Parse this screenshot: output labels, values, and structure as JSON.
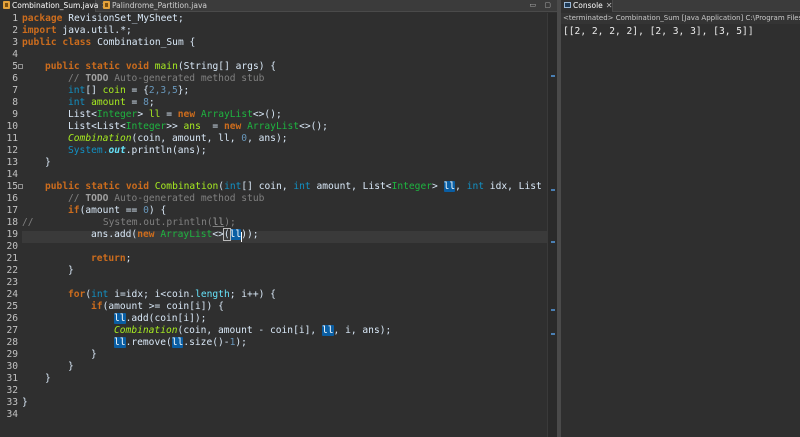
{
  "editor": {
    "tabs": [
      {
        "label": "Combination_Sum.java",
        "active": true
      },
      {
        "label": "Palindrome_Partition.java",
        "active": false
      }
    ],
    "line_numbers": [
      "1",
      "2",
      "3",
      "4",
      "5",
      "6",
      "7",
      "8",
      "9",
      "10",
      "11",
      "12",
      "13",
      "14",
      "15",
      "16",
      "17",
      "18",
      "19",
      "20",
      "21",
      "22",
      "23",
      "24",
      "25",
      "26",
      "27",
      "28",
      "29",
      "30",
      "31",
      "32",
      "33",
      "34"
    ],
    "code": {
      "l1_kw": "package",
      "l1_txt": " RevisionSet_MySheet;",
      "l2_kw": "import",
      "l2_txt": " java.util.*;",
      "l3_kw": "public class",
      "l3_txt": " Combination_Sum {",
      "l5_kw": "public static void",
      "l5_m": " main",
      "l5_a": "(String[] args) {",
      "l6_c1": "// ",
      "l6_todo": "TODO",
      "l6_c2": " Auto-generated method stub",
      "l7_ty": "int",
      "l7_a": "[] ",
      "l7_v": "coin",
      "l7_b": " = {",
      "l7_n": "2,3,5",
      "l7_c": "};",
      "l8_ty": "int",
      "l8_a": " ",
      "l8_v": "amount",
      "l8_b": " = ",
      "l8_n": "8",
      "l8_c": ";",
      "l9_a": "List<",
      "l9_cls": "Integer",
      "l9_b": "> ",
      "l9_v": "ll",
      "l9_c": " = ",
      "l9_kw": "new",
      "l9_d": " ",
      "l9_cls2": "ArrayList",
      "l9_e": "<>();",
      "l10_a": "List<List<",
      "l10_cls": "Integer",
      "l10_b": ">> ",
      "l10_v": "ans",
      "l10_c": "  = ",
      "l10_kw": "new",
      "l10_d": " ",
      "l10_cls2": "ArrayList",
      "l10_e": "<>();",
      "l11_m": "Combination",
      "l11_a": "(coin, amount, ll, ",
      "l11_n": "0",
      "l11_b": ", ans);",
      "l12_a": "System.",
      "l12_f": "out",
      "l12_b": ".println(ans);",
      "l13": "}",
      "l15_kw": "public static void",
      "l15_m": " Combination",
      "l15_a": "(",
      "l15_ty": "int",
      "l15_b": "[] coin, ",
      "l15_ty2": "int",
      "l15_c": " amount, List<",
      "l15_cls": "Integer",
      "l15_d": "> ",
      "l15_hl": "ll",
      "l15_e": ", ",
      "l15_ty3": "int",
      "l15_f": " idx, List",
      "l16_c1": "// ",
      "l16_todo": "TODO",
      "l16_c2": " Auto-generated method stub",
      "l17_kw": "if",
      "l17_a": "(amount == ",
      "l17_n": "0",
      "l17_b": ") {",
      "l18_c": "//",
      "l18_a": "            System.out.println(",
      "l18_u": "ll",
      "l18_b": ");",
      "l19_a": "ans.add(",
      "l19_kw": "new",
      "l19_b": " ",
      "l19_cls": "ArrayList",
      "l19_c": "<>",
      "l19_d": "(",
      "l19_hl": "ll",
      "l19_e": "));",
      "l21_kw": "return",
      "l21_a": ";",
      "l22": "}",
      "l24_kw": "for",
      "l24_a": "(",
      "l24_ty": "int",
      "l24_b": " i=idx; i<coin.",
      "l24_f": "length",
      "l24_c": "; i++) {",
      "l25_kw": "if",
      "l25_a": "(amount >= coin[i]) {",
      "l26_hl": "ll",
      "l26_a": ".add(coin[i]);",
      "l27_m": "Combination",
      "l27_a": "(coin, amount - coin[i], ",
      "l27_hl": "ll",
      "l27_b": ", i, ans);",
      "l28_hl": "ll",
      "l28_a": ".remove(",
      "l28_hl2": "ll",
      "l28_b": ".size()-",
      "l28_n": "1",
      "l28_c": ");",
      "l29": "}",
      "l30": "}",
      "l31": "}",
      "l33": "}"
    },
    "window_controls": "▭ ▢"
  },
  "console": {
    "tab_label": "Console",
    "status": "<terminated> Combination_Sum [Java Application] C:\\Program Files",
    "output": "[[2, 2, 2, 2], [2, 3, 3], [3, 5]]"
  },
  "colors": {
    "editor_bg": "#2f2f2f",
    "keyword": "#cc6c1d",
    "type": "#1290c3",
    "class": "#1eb540",
    "comment": "#808080",
    "method": "#a7ec21",
    "highlight": "#0a5ea3"
  }
}
